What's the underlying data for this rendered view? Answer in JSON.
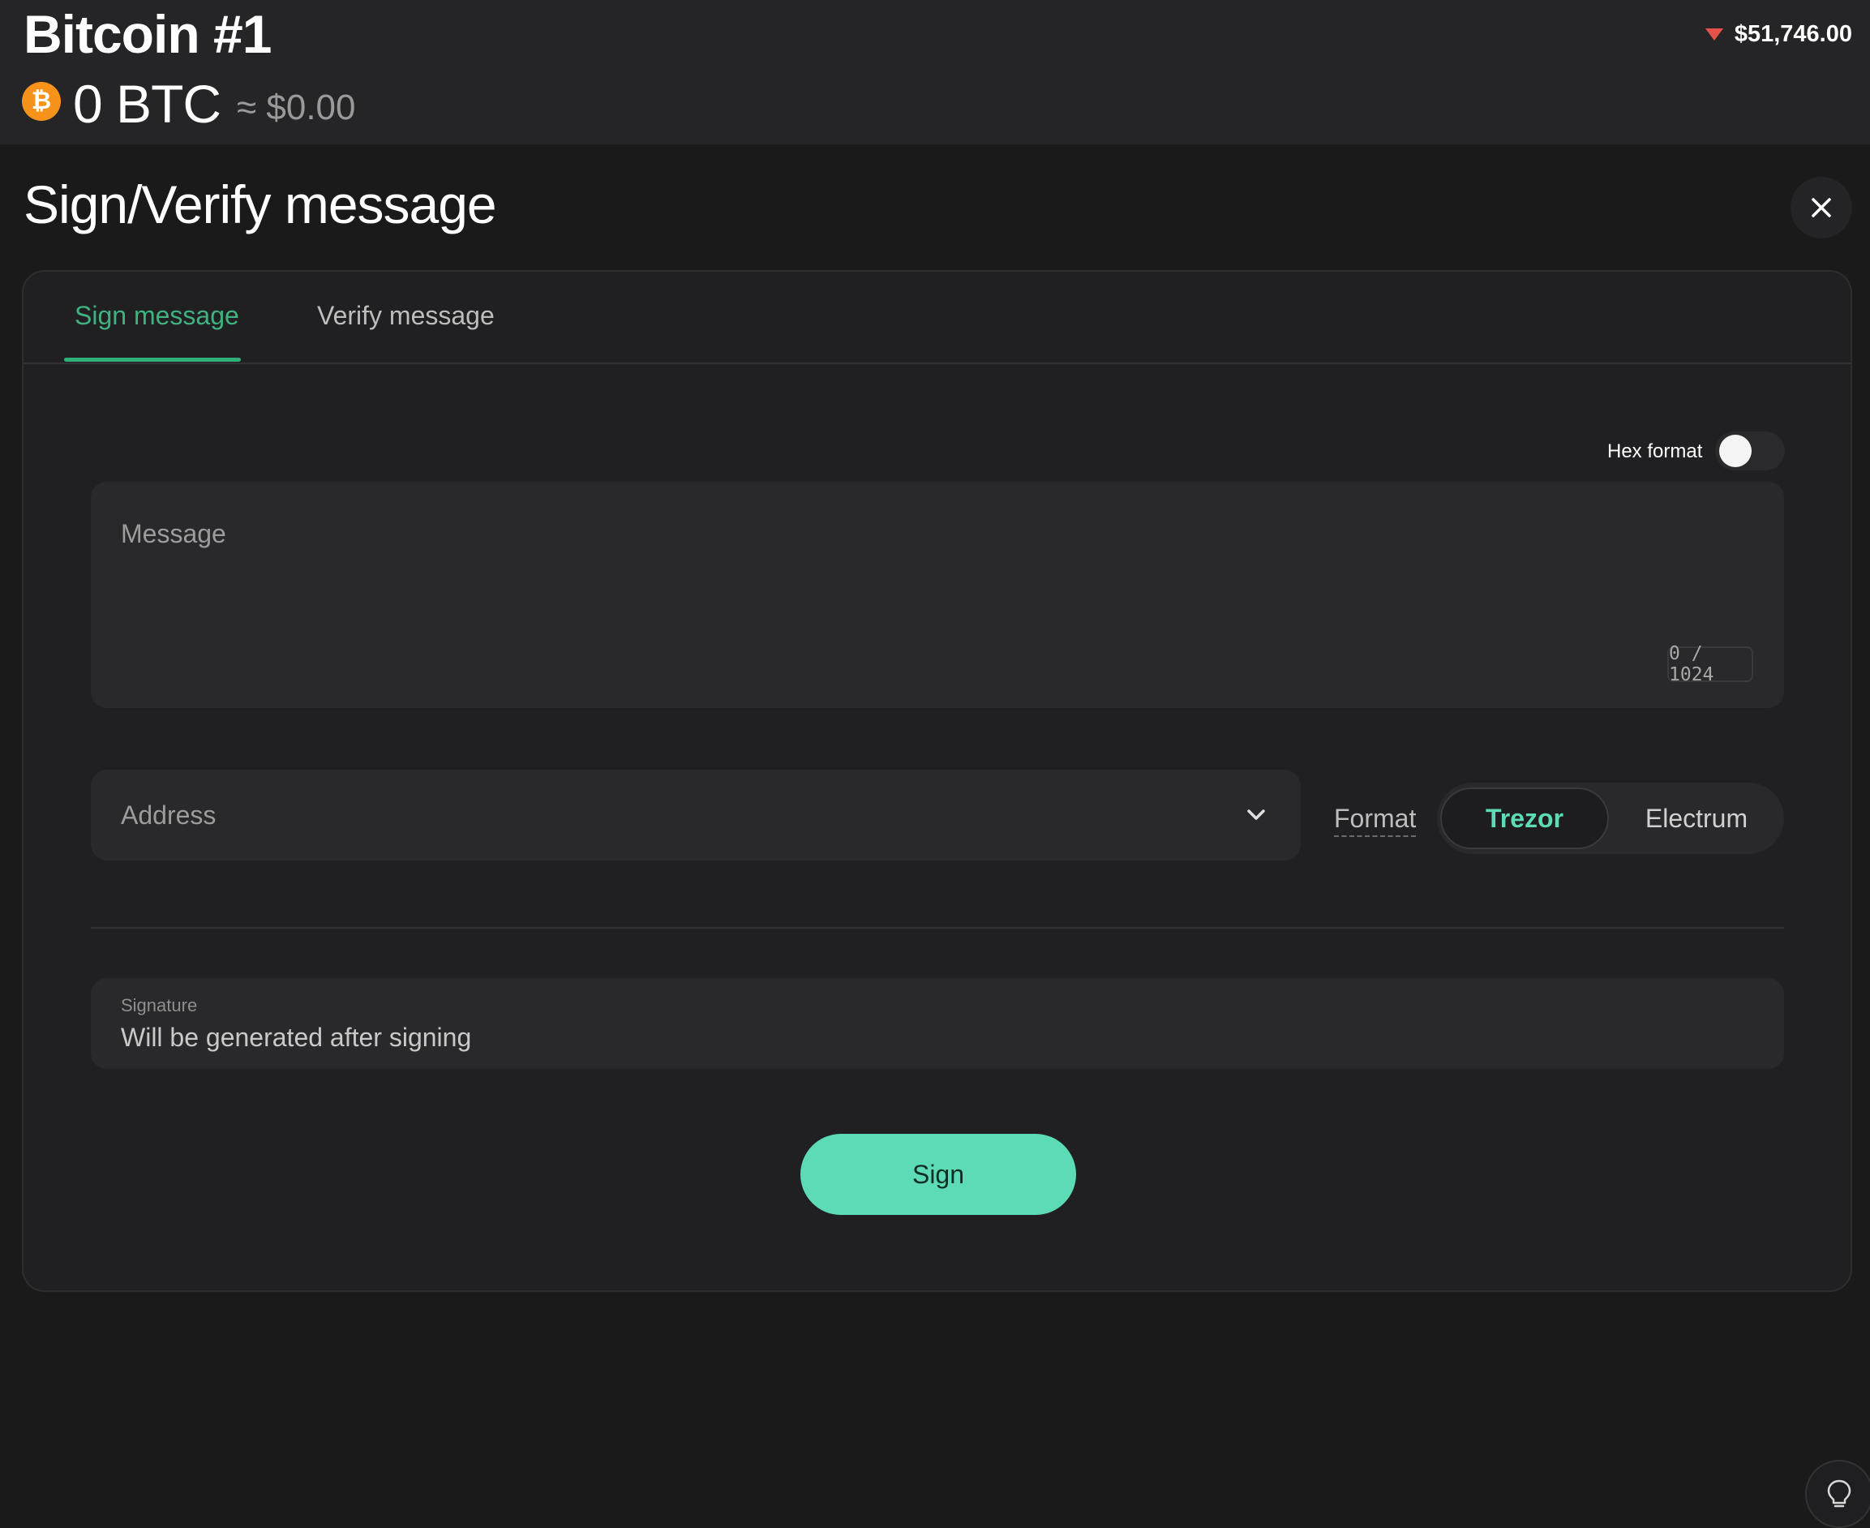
{
  "header": {
    "account_name": "Bitcoin #1",
    "balance": "0 BTC",
    "fiat_balance": "≈ $0.00",
    "price": "$51,746.00",
    "price_trend": "down",
    "coin_icon": "bitcoin-icon",
    "coin_symbol": "₿"
  },
  "modal": {
    "title": "Sign/Verify message",
    "close_icon": "close-icon"
  },
  "tabs": [
    {
      "label": "Sign message",
      "active": true
    },
    {
      "label": "Verify message",
      "active": false
    }
  ],
  "form": {
    "hex_format_label": "Hex format",
    "hex_format_enabled": false,
    "message_placeholder": "Message",
    "message_counter": "0 / 1024",
    "address_placeholder": "Address",
    "format_label": "Format",
    "format_options": [
      "Trezor",
      "Electrum"
    ],
    "format_selected": "Trezor",
    "signature_label": "Signature",
    "signature_value": "Will be generated after signing",
    "sign_button": "Sign"
  },
  "colors": {
    "accent": "#5cdbb6",
    "tab_active": "#3fb27f",
    "background": "#1a1a1a",
    "price_down": "#e5524a",
    "bitcoin": "#f7931a"
  }
}
